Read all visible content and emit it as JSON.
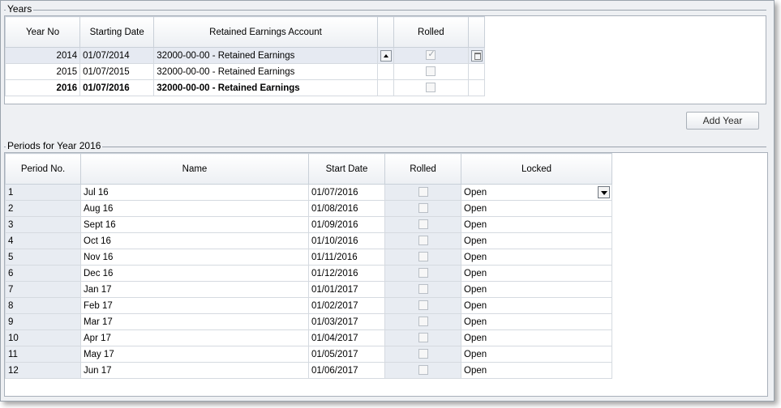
{
  "years_group": {
    "title": "Years",
    "columns": [
      "Year No",
      "Starting Date",
      "Retained Earnings Account",
      "",
      "Rolled",
      ""
    ],
    "rows": [
      {
        "year": "2014",
        "date": "01/07/2014",
        "account": "32000-00-00 - Retained Earnings",
        "rolled": true
      },
      {
        "year": "2015",
        "date": "01/07/2015",
        "account": "32000-00-00 - Retained Earnings",
        "rolled": false
      },
      {
        "year": "2016",
        "date": "01/07/2016",
        "account": "32000-00-00 - Retained Earnings",
        "rolled": false
      }
    ],
    "add_year_label": "Add Year"
  },
  "periods_group": {
    "title": "Periods for Year 2016",
    "columns": [
      "Period No.",
      "Name",
      "Start Date",
      "Rolled",
      "Locked"
    ],
    "rows": [
      {
        "no": "1",
        "name": "Jul 16",
        "date": "01/07/2016",
        "locked": "Open"
      },
      {
        "no": "2",
        "name": "Aug 16",
        "date": "01/08/2016",
        "locked": "Open"
      },
      {
        "no": "3",
        "name": "Sept 16",
        "date": "01/09/2016",
        "locked": "Open"
      },
      {
        "no": "4",
        "name": "Oct 16",
        "date": "01/10/2016",
        "locked": "Open"
      },
      {
        "no": "5",
        "name": "Nov 16",
        "date": "01/11/2016",
        "locked": "Open"
      },
      {
        "no": "6",
        "name": "Dec 16",
        "date": "01/12/2016",
        "locked": "Open"
      },
      {
        "no": "7",
        "name": "Jan 17",
        "date": "01/01/2017",
        "locked": "Open"
      },
      {
        "no": "8",
        "name": "Feb 17",
        "date": "01/02/2017",
        "locked": "Open"
      },
      {
        "no": "9",
        "name": "Mar 17",
        "date": "01/03/2017",
        "locked": "Open"
      },
      {
        "no": "10",
        "name": "Apr 17",
        "date": "01/04/2017",
        "locked": "Open"
      },
      {
        "no": "11",
        "name": "May 17",
        "date": "01/05/2017",
        "locked": "Open"
      },
      {
        "no": "12",
        "name": "Jun 17",
        "date": "01/06/2017",
        "locked": "Open"
      }
    ]
  },
  "icons": {
    "scroll_up": "up-arrow-icon",
    "delete": "trash-icon",
    "dropdown": "chevron-down-icon"
  }
}
